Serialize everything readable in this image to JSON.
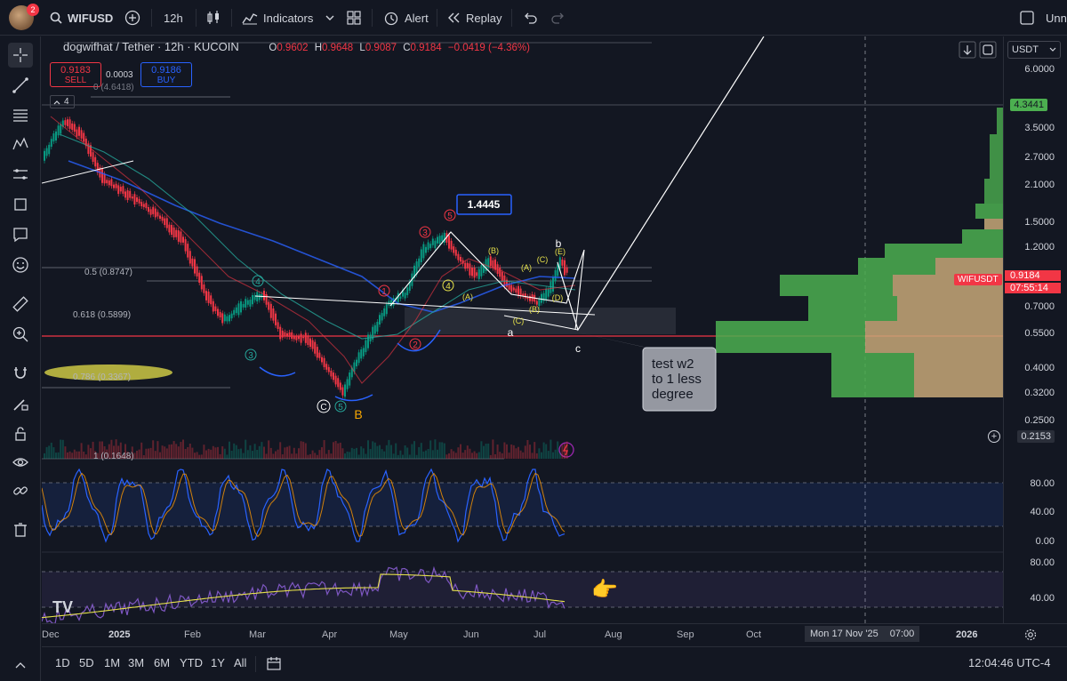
{
  "header": {
    "notification_count": "2",
    "symbol": "WIFUSD",
    "interval": "12h",
    "indicators_label": "Indicators",
    "alert_label": "Alert",
    "replay_label": "Replay",
    "right_truncated": "Unn"
  },
  "legend": {
    "title": "dogwifhat / Tether · 12h · KUCOIN",
    "open_key": "O",
    "open": "0.9602",
    "high_key": "H",
    "high": "0.9648",
    "low_key": "L",
    "low": "0.9087",
    "close_key": "C",
    "close": "0.9184",
    "change": "−0.0419 (−4.36%)",
    "sell_price": "0.9183",
    "sell_label": "SELL",
    "spread": "0.0003",
    "buy_price": "0.9186",
    "buy_label": "BUY",
    "hidden_count": "4",
    "fib_top": "0 (4.6418)"
  },
  "fib_levels": [
    {
      "label": "0.5 (0.8747)"
    },
    {
      "label": "0.618 (0.5899)"
    },
    {
      "label": "0.786 (0.3367)"
    },
    {
      "label": "1 (0.1648)"
    }
  ],
  "annotations": {
    "price_callout": "1.4445",
    "note": [
      "test w2",
      "to 1 less",
      "degree"
    ],
    "wave_labels": [
      "1",
      "2",
      "3",
      "4",
      "5",
      "(A)",
      "(B)",
      "(C)",
      "(D)",
      "(E)",
      "a",
      "b",
      "c",
      "B",
      "C",
      "3",
      "4",
      "5"
    ]
  },
  "price_scale": {
    "currency": "USDT",
    "labels": [
      "6.0000",
      "4.3441",
      "3.5000",
      "2.7000",
      "2.1000",
      "1.5000",
      "1.2000",
      "0.7000",
      "0.5500",
      "0.4000",
      "0.3200",
      "0.2500",
      "0.2153",
      "80.00",
      "40.00",
      "0.00",
      "80.00",
      "40.00"
    ],
    "top_level": "4.3441",
    "current_symbol": "WIFUSDT",
    "current_price": "0.9184",
    "countdown": "07:55:14",
    "crosshair_price": "0.2153"
  },
  "time_scale": {
    "labels": [
      "Dec",
      "2025",
      "Feb",
      "Mar",
      "Apr",
      "May",
      "Jun",
      "Jul",
      "Aug",
      "Sep",
      "Oct",
      "2026"
    ],
    "crosshair_date": "Mon 17 Nov '25",
    "crosshair_time": "07:00"
  },
  "bottom": {
    "ranges": [
      "1D",
      "5D",
      "1M",
      "3M",
      "6M",
      "YTD",
      "1Y",
      "All"
    ],
    "clock": "12:04:46 UTC-4"
  },
  "colors": {
    "background": "#131722",
    "down": "#f23645",
    "up": "#089981",
    "accent": "#2962ff",
    "volume_profile_green": "#4caf50",
    "volume_profile_tan": "#c8a878"
  }
}
